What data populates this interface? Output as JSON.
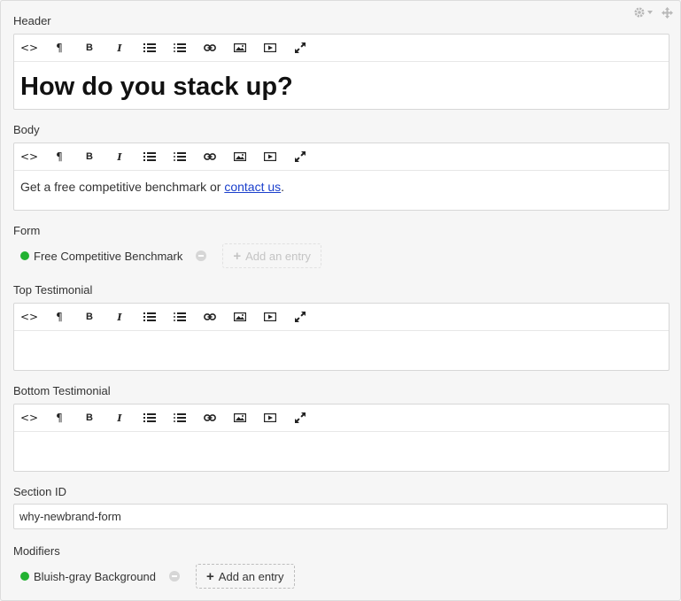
{
  "toolbar_buttons": [
    {
      "name": "html-source",
      "glyph": "<>"
    },
    {
      "name": "paragraph",
      "glyph": "¶"
    },
    {
      "name": "bold",
      "glyph": "B"
    },
    {
      "name": "italic",
      "glyph": "I"
    },
    {
      "name": "unordered-list",
      "glyph": ""
    },
    {
      "name": "ordered-list",
      "glyph": ""
    },
    {
      "name": "link",
      "glyph": ""
    },
    {
      "name": "image",
      "glyph": ""
    },
    {
      "name": "video",
      "glyph": ""
    },
    {
      "name": "fullscreen",
      "glyph": ""
    }
  ],
  "fields": {
    "header": {
      "label": "Header",
      "content": "How do you stack up?"
    },
    "body": {
      "label": "Body",
      "text_before": "Get a free competitive benchmark or ",
      "link_text": "contact us",
      "text_after": "."
    },
    "form": {
      "label": "Form",
      "entry": "Free Competitive Benchmark",
      "add_label": "Add an entry"
    },
    "top_testimonial": {
      "label": "Top Testimonial",
      "content": ""
    },
    "bottom_testimonial": {
      "label": "Bottom Testimonial",
      "content": ""
    },
    "section_id": {
      "label": "Section ID",
      "value": "why-newbrand-form"
    },
    "modifiers": {
      "label": "Modifiers",
      "entry": "Bluish-gray Background",
      "add_label": "Add an entry"
    }
  },
  "colors": {
    "status_dot": "#22b231",
    "link": "#1a3fcc",
    "background": "#f6f6f6"
  }
}
